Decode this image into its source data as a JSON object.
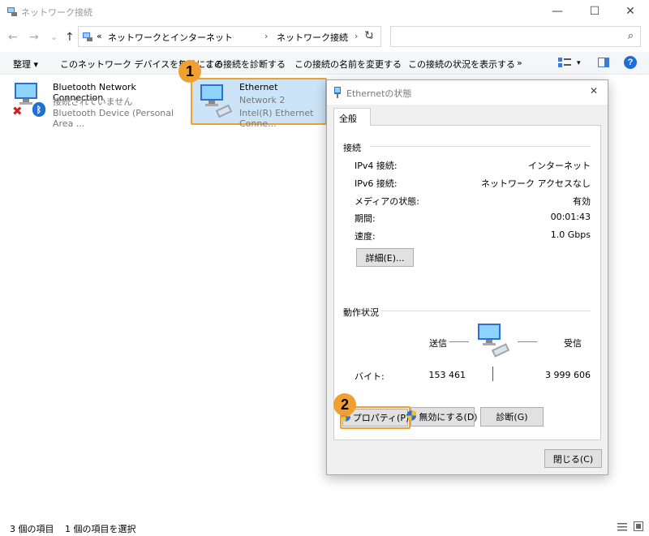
{
  "window": {
    "title": "ネットワーク接続",
    "controls": {
      "minimize": "—",
      "maximize": "☐",
      "close": "✕"
    }
  },
  "address": {
    "back": "←",
    "forward": "→",
    "recent": "⌄",
    "up": "↑",
    "prefix": "«",
    "crumbs": [
      "ネットワークとインターネット",
      "ネットワーク接続"
    ],
    "sep": "›",
    "dropdown": "⌄",
    "refresh": "↻",
    "search_icon": "⌕"
  },
  "commands": {
    "organize": "整理 ▾",
    "disable": "このネットワーク デバイスを無効にする",
    "diagnose": "この接続を診断する",
    "rename": "この接続の名前を変更する",
    "status": "この接続の状況を表示する",
    "more": "»",
    "view_caret": "▾"
  },
  "items": [
    {
      "name": "Bluetooth Network Connection",
      "status": "接続されていません",
      "device": "Bluetooth Device (Personal Area ..."
    },
    {
      "name": "Ethernet",
      "status": "Network 2",
      "device": "Intel(R) Ethernet Conne..."
    }
  ],
  "badges": {
    "one": "1",
    "two": "2"
  },
  "dialog": {
    "title": "Ethernetの状態",
    "close": "✕",
    "tab": "全般",
    "connection": {
      "header": "接続",
      "rows": [
        {
          "label": "IPv4 接続:",
          "value": "インターネット"
        },
        {
          "label": "IPv6 接続:",
          "value": "ネットワーク アクセスなし"
        },
        {
          "label": "メディアの状態:",
          "value": "有効"
        },
        {
          "label": "期間:",
          "value": "00:01:43"
        },
        {
          "label": "速度:",
          "value": "1.0 Gbps"
        }
      ],
      "details_button": "詳細(E)..."
    },
    "activity": {
      "header": "動作状況",
      "sent": "送信",
      "received": "受信",
      "bytes_label": "バイト:",
      "bytes_sent": "153 461",
      "bytes_received": "3 999 606"
    },
    "buttons": {
      "properties": "プロパティ(P)",
      "disable": "無効にする(D)",
      "diagnose": "診断(G)",
      "close": "閉じる(C)"
    }
  },
  "statusbar": {
    "count": "3 個の項目",
    "selected": "1 個の項目を選択"
  }
}
